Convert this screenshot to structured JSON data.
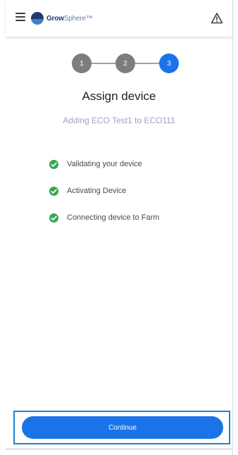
{
  "header": {
    "menu_icon": "menu-icon",
    "brand_bold": "Grow",
    "brand_light": "Sphere",
    "brand_tm": "™",
    "alert_icon": "warning-triangle-icon"
  },
  "stepper": {
    "steps": [
      {
        "label": "1",
        "state": "completed"
      },
      {
        "label": "2",
        "state": "completed"
      },
      {
        "label": "3",
        "state": "active"
      }
    ],
    "colors": {
      "completed": "#7d7d7d",
      "active": "#1a73e8"
    }
  },
  "content": {
    "title": "Assign device",
    "subtitle": "Adding ECO Test1 to ECO111",
    "status_items": [
      {
        "label": "Validating your device",
        "icon": "check-circle-icon",
        "state": "done"
      },
      {
        "label": "Activating Device",
        "icon": "check-circle-icon",
        "state": "done"
      },
      {
        "label": "Connecting device to Farm",
        "icon": "check-circle-icon",
        "state": "done"
      }
    ],
    "status_color": "#34a853"
  },
  "footer": {
    "continue_label": "Continue",
    "accent_color": "#1a73e8"
  }
}
